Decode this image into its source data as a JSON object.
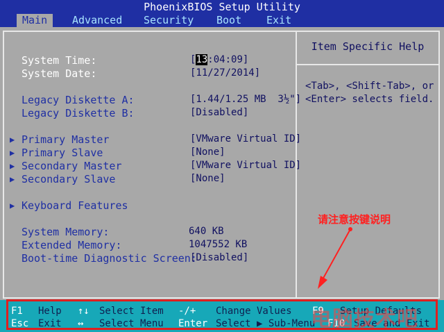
{
  "window": {
    "title": "PhoenixBIOS Setup Utility"
  },
  "menu": [
    {
      "label": "Main",
      "active": true
    },
    {
      "label": "Advanced"
    },
    {
      "label": "Security"
    },
    {
      "label": "Boot"
    },
    {
      "label": "Exit"
    }
  ],
  "main": {
    "system_time": {
      "label": "System Time:",
      "value_hour": "13",
      "value_rest": ":04:09]",
      "open_bracket": "["
    },
    "system_date": {
      "label": "System Date:",
      "value": "[11/27/2014]"
    },
    "legacy_a": {
      "label": "Legacy Diskette A:",
      "value": "[1.44/1.25 MB  3½\"]"
    },
    "legacy_b": {
      "label": "Legacy Diskette B:",
      "value": "[Disabled]"
    },
    "primary_master": {
      "label": "Primary Master",
      "value": "[VMware Virtual ID]"
    },
    "primary_slave": {
      "label": "Primary Slave",
      "value": "[None]"
    },
    "secondary_master": {
      "label": "Secondary Master",
      "value": "[VMware Virtual ID]"
    },
    "secondary_slave": {
      "label": "Secondary Slave",
      "value": "[None]"
    },
    "keyboard_features": {
      "label": "Keyboard Features"
    },
    "system_memory": {
      "label": "System Memory:",
      "value": "640 KB"
    },
    "extended_memory": {
      "label": "Extended Memory:",
      "value": "1047552 KB"
    },
    "boot_diag": {
      "label": "Boot-time Diagnostic Screen:",
      "value": "[Disabled]"
    }
  },
  "help": {
    "title": "Item Specific Help",
    "line1": "<Tab>, <Shift-Tab>, or",
    "line2": "<Enter> selects field."
  },
  "footer": {
    "f1": "F1",
    "help": "Help",
    "updown": "↑↓",
    "select_item": "Select Item",
    "minusplus": "-/+",
    "change_values": "Change Values",
    "f9": "F9",
    "setup_defaults": "Setup Defaults",
    "esc": "Esc",
    "exit": "Exit",
    "leftright": "↔",
    "select_menu": "Select Menu",
    "enter": "Enter",
    "select_submenu": "Select ▶ Sub-Menu",
    "f10": "F10",
    "save_exit": "Save and Exit"
  },
  "annotation": {
    "text": "请注意按键说明"
  },
  "watermark": {
    "text": "电脑技术吧"
  },
  "colors": {
    "bios_blue": "#1f2fa3",
    "panel_gray": "#a8a8a8",
    "footer_cyan": "#17a8b8",
    "highlight_red": "#e02020"
  }
}
